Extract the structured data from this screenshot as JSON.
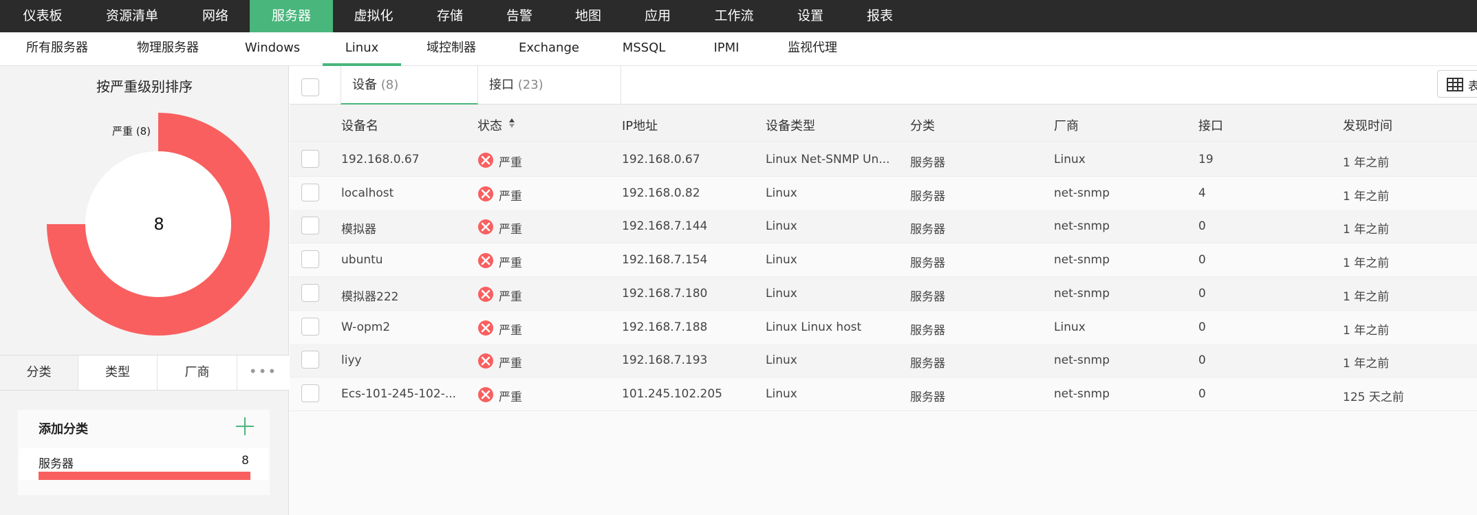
{
  "topnav": {
    "items": [
      "仪表板",
      "资源清单",
      "网络",
      "服务器",
      "虚拟化",
      "存储",
      "告警",
      "地图",
      "应用",
      "工作流",
      "设置",
      "报表"
    ],
    "active_index": 3
  },
  "subnav": {
    "items": [
      "所有服务器",
      "物理服务器",
      "Windows",
      "Linux",
      "域控制器",
      "Exchange",
      "MSSQL",
      "IPMI",
      "监视代理"
    ],
    "active_index": 3
  },
  "left": {
    "chart_title": "按严重级别排序",
    "donut_label": "严重 (8)",
    "donut_center": "8",
    "severity_color": "#f95f5f",
    "filter_tabs": [
      "分类",
      "类型",
      "厂商"
    ],
    "more": "•••",
    "category": {
      "header": "添加分类",
      "row": {
        "name": "服务器",
        "count": "8"
      }
    }
  },
  "main": {
    "tabs": [
      {
        "label": "设备",
        "count": "(8)"
      },
      {
        "label": "接口",
        "count": "(23)"
      }
    ],
    "view_label": "表",
    "columns": [
      "设备名",
      "状态",
      "IP地址",
      "设备类型",
      "分类",
      "厂商",
      "接口",
      "发现时间"
    ],
    "rows": [
      {
        "name": "192.168.0.67",
        "status": "严重",
        "ip": "192.168.0.67",
        "type": "Linux Net-SNMP Un...",
        "category": "服务器",
        "vendor": "Linux",
        "interfaces": "19",
        "discovered": "1 年之前"
      },
      {
        "name": "localhost",
        "status": "严重",
        "ip": "192.168.0.82",
        "type": "Linux",
        "category": "服务器",
        "vendor": "net-snmp",
        "interfaces": "4",
        "discovered": "1 年之前"
      },
      {
        "name": "模拟器",
        "status": "严重",
        "ip": "192.168.7.144",
        "type": "Linux",
        "category": "服务器",
        "vendor": "net-snmp",
        "interfaces": "0",
        "discovered": "1 年之前"
      },
      {
        "name": "ubuntu",
        "status": "严重",
        "ip": "192.168.7.154",
        "type": "Linux",
        "category": "服务器",
        "vendor": "net-snmp",
        "interfaces": "0",
        "discovered": "1 年之前"
      },
      {
        "name": "模拟器222",
        "status": "严重",
        "ip": "192.168.7.180",
        "type": "Linux",
        "category": "服务器",
        "vendor": "net-snmp",
        "interfaces": "0",
        "discovered": "1 年之前"
      },
      {
        "name": "W-opm2",
        "status": "严重",
        "ip": "192.168.7.188",
        "type": "Linux Linux host",
        "category": "服务器",
        "vendor": "Linux",
        "interfaces": "0",
        "discovered": "1 年之前"
      },
      {
        "name": "liyy",
        "status": "严重",
        "ip": "192.168.7.193",
        "type": "Linux",
        "category": "服务器",
        "vendor": "net-snmp",
        "interfaces": "0",
        "discovered": "1 年之前"
      },
      {
        "name": "Ecs-101-245-102-...",
        "status": "严重",
        "ip": "101.245.102.205",
        "type": "Linux",
        "category": "服务器",
        "vendor": "net-snmp",
        "interfaces": "0",
        "discovered": "125 天之前"
      }
    ]
  },
  "colors": {
    "accent": "#49b67c",
    "critical": "#f95f5f",
    "topbar": "#2b2b2b"
  }
}
